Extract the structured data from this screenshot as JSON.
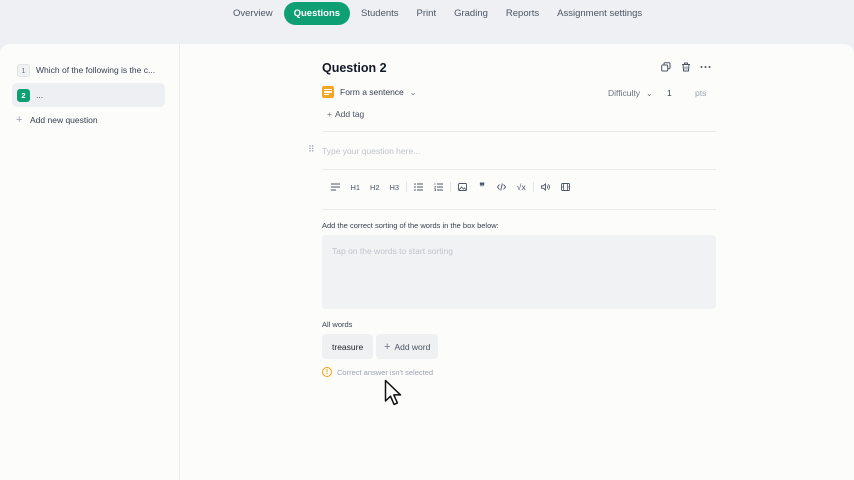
{
  "nav": {
    "tabs": [
      {
        "label": "Overview"
      },
      {
        "label": "Questions"
      },
      {
        "label": "Students"
      },
      {
        "label": "Print"
      },
      {
        "label": "Grading"
      },
      {
        "label": "Reports"
      },
      {
        "label": "Assignment settings"
      }
    ],
    "active_tab": "Questions"
  },
  "sidebar": {
    "questions": [
      {
        "num": "1",
        "text": "Which of the following is the c..."
      },
      {
        "num": "2",
        "text": "..."
      }
    ],
    "add_label": "Add new question"
  },
  "editor": {
    "title": "Question 2",
    "type_label": "Form a sentence",
    "difficulty_label": "Difficulty",
    "points_value": "1",
    "points_unit": "pts",
    "add_tag_label": "Add tag",
    "question_placeholder": "Type your question here...",
    "toolbar": [
      "H1",
      "H2",
      "H3"
    ],
    "instruction": "Add the correct sorting of the words in the box below:",
    "answer_placeholder": "Tap on the words to start sorting",
    "all_words_label": "All words",
    "words": [
      "treasure"
    ],
    "add_word_label": "Add word",
    "warning": "Correct answer isn't selected"
  },
  "colors": {
    "accent": "#0e9f74",
    "type_icon": "#f5a524",
    "warning": "#f59e0b"
  }
}
